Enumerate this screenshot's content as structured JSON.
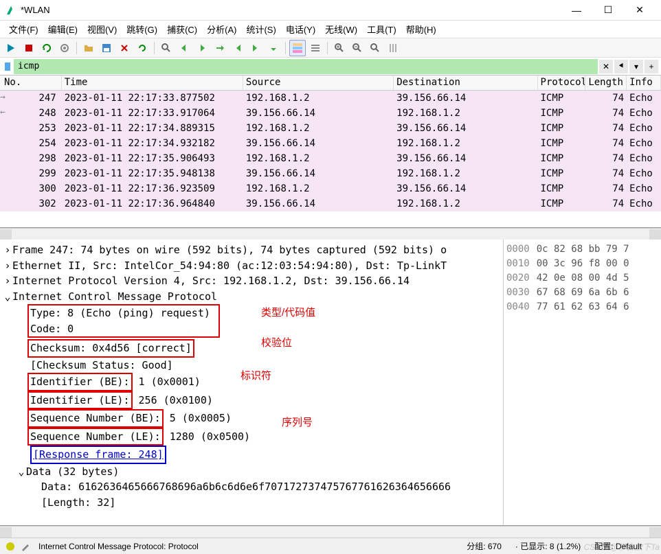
{
  "window": {
    "title": "*WLAN"
  },
  "menu": {
    "file": "文件(F)",
    "edit": "编辑(E)",
    "view": "视图(V)",
    "go": "跳转(G)",
    "capture": "捕获(C)",
    "analyze": "分析(A)",
    "stats": "统计(S)",
    "telephony": "电话(Y)",
    "wireless": "无线(W)",
    "tools": "工具(T)",
    "help": "帮助(H)"
  },
  "filter": {
    "value": "icmp",
    "clear": "✕",
    "back": "⯇",
    "ext": "▾",
    "plus": "+"
  },
  "columns": {
    "no": "No.",
    "time": "Time",
    "source": "Source",
    "destination": "Destination",
    "protocol": "Protocol",
    "length": "Length",
    "info": "Info"
  },
  "packets": [
    {
      "no": "247",
      "time": "2023-01-11 22:17:33.877502",
      "src": "192.168.1.2",
      "dst": "39.156.66.14",
      "proto": "ICMP",
      "len": "74",
      "info": "Echo"
    },
    {
      "no": "248",
      "time": "2023-01-11 22:17:33.917064",
      "src": "39.156.66.14",
      "dst": "192.168.1.2",
      "proto": "ICMP",
      "len": "74",
      "info": "Echo"
    },
    {
      "no": "253",
      "time": "2023-01-11 22:17:34.889315",
      "src": "192.168.1.2",
      "dst": "39.156.66.14",
      "proto": "ICMP",
      "len": "74",
      "info": "Echo"
    },
    {
      "no": "254",
      "time": "2023-01-11 22:17:34.932182",
      "src": "39.156.66.14",
      "dst": "192.168.1.2",
      "proto": "ICMP",
      "len": "74",
      "info": "Echo"
    },
    {
      "no": "298",
      "time": "2023-01-11 22:17:35.906493",
      "src": "192.168.1.2",
      "dst": "39.156.66.14",
      "proto": "ICMP",
      "len": "74",
      "info": "Echo"
    },
    {
      "no": "299",
      "time": "2023-01-11 22:17:35.948138",
      "src": "39.156.66.14",
      "dst": "192.168.1.2",
      "proto": "ICMP",
      "len": "74",
      "info": "Echo"
    },
    {
      "no": "300",
      "time": "2023-01-11 22:17:36.923509",
      "src": "192.168.1.2",
      "dst": "39.156.66.14",
      "proto": "ICMP",
      "len": "74",
      "info": "Echo"
    },
    {
      "no": "302",
      "time": "2023-01-11 22:17:36.964840",
      "src": "39.156.66.14",
      "dst": "192.168.1.2",
      "proto": "ICMP",
      "len": "74",
      "info": "Echo"
    }
  ],
  "details": {
    "frame": "Frame 247: 74 bytes on wire (592 bits), 74 bytes captured (592 bits) o",
    "eth": "Ethernet II, Src: IntelCor_54:94:80 (ac:12:03:54:94:80), Dst: Tp-LinkT",
    "ip": "Internet Protocol Version 4, Src: 192.168.1.2, Dst: 39.156.66.14",
    "icmp": "Internet Control Message Protocol",
    "type": "Type: 8 (Echo (ping) request)",
    "code": "Code: 0",
    "checksum": "Checksum: 0x4d56 [correct]",
    "checksum_status": "[Checksum Status: Good]",
    "id_be_lbl": "Identifier (BE):",
    "id_be_val": " 1 (0x0001)",
    "id_le_lbl": "Identifier (LE):",
    "id_le_val": " 256 (0x0100)",
    "seq_be_lbl": "Sequence Number (BE):",
    "seq_be_val": "5 (0x0005)",
    "seq_le_lbl": "Sequence Number (LE):",
    "seq_le_val": "1280 (0x0500)",
    "response": "[Response frame: 248]",
    "data_hdr": "Data (32 bytes)",
    "data_val": "Data: 6162636465666768696a6b6c6d6e6f707172737475767761626364656666",
    "data_len": "[Length: 32]"
  },
  "annotations": {
    "type_code": "类型/代码值",
    "checksum": "校验位",
    "identifier": "标识符",
    "sequence": "序列号"
  },
  "hex": [
    {
      "addr": "0000",
      "bytes": "0c 82 68 bb 79 7"
    },
    {
      "addr": "0010",
      "bytes": "00 3c 96 f8 00 0"
    },
    {
      "addr": "0020",
      "bytes": "42 0e 08 00 4d 5"
    },
    {
      "addr": "0030",
      "bytes": "67 68 69 6a 6b 6"
    },
    {
      "addr": "0040",
      "bytes": "77 61 62 63 64 6"
    }
  ],
  "statusbar": {
    "selected": "Internet Control Message Protocol: Protocol",
    "packets": "分组: 670",
    "displayed": "已显示: 8 (1.2%)",
    "profile": "配置: Default"
  },
  "watermark": "CSDN @学会放下Ta"
}
